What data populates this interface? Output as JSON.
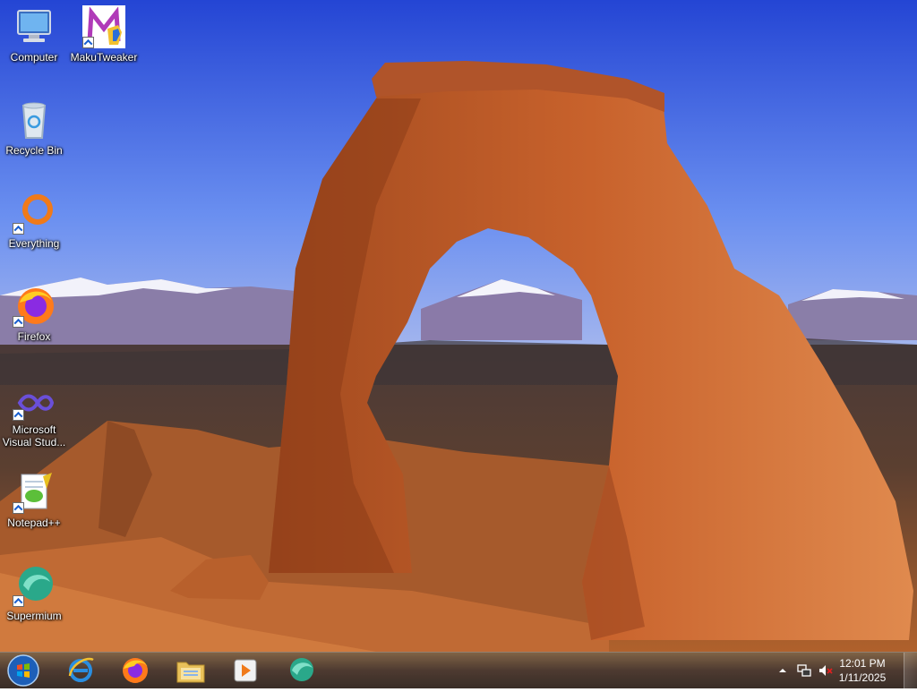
{
  "desktop": {
    "wallpaper": "delicate-arch-landscape",
    "icons": [
      {
        "name": "computer-icon",
        "label": "Computer",
        "shortcut": false
      },
      {
        "name": "makutweaker-icon",
        "label": "MakuTweaker",
        "shortcut": true
      },
      {
        "name": "recycle-bin-icon",
        "label": "Recycle Bin",
        "shortcut": false
      },
      {
        "name": "everything-icon",
        "label": "Everything",
        "shortcut": true
      },
      {
        "name": "firefox-icon",
        "label": "Firefox",
        "shortcut": true
      },
      {
        "name": "visual-studio-icon",
        "label": "Microsoft Visual Stud...",
        "shortcut": true
      },
      {
        "name": "notepadpp-icon",
        "label": "Notepad++",
        "shortcut": true
      },
      {
        "name": "supermium-icon",
        "label": "Supermium",
        "shortcut": true
      }
    ]
  },
  "taskbar": {
    "start": "windows-orb-icon",
    "pinned": [
      "internet-explorer-icon",
      "firefox-icon",
      "file-explorer-icon",
      "media-player-icon",
      "supermium-icon"
    ],
    "tray": {
      "overflow_icon": "chevron-up-icon",
      "network_icon": "network-icon",
      "volume_icon": "volume-muted-icon",
      "time": "12:01 PM",
      "date": "1/11/2025"
    }
  },
  "colors": {
    "sky": "#3f6ae6",
    "rock": "#c8743a",
    "taskbar": "#4a3628"
  }
}
